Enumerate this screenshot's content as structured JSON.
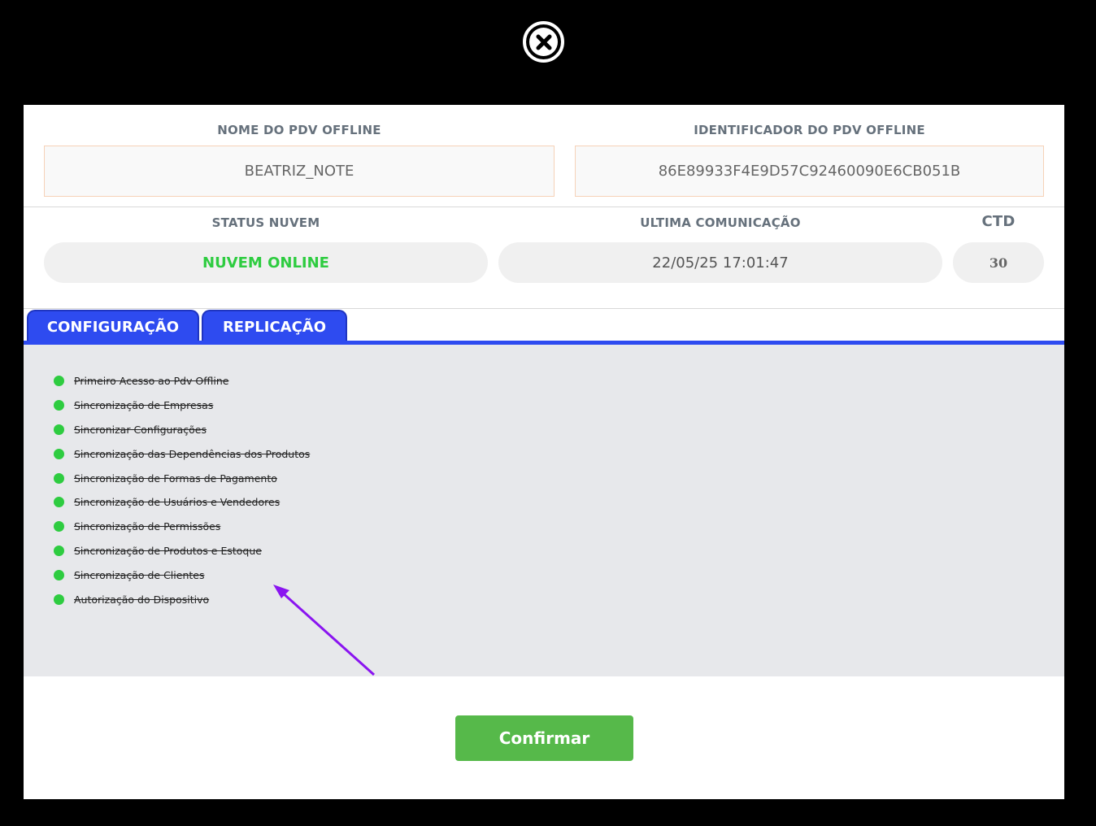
{
  "header": {
    "pdv_name_label": "NOME DO PDV OFFLINE",
    "pdv_name_value": "BEATRIZ_NOTE",
    "pdv_id_label": "IDENTIFICADOR DO PDV OFFLINE",
    "pdv_id_value": "86E89933F4E9D57C92460090E6CB051B"
  },
  "status": {
    "cloud_label": "STATUS NUVEM",
    "cloud_value": "NUVEM ONLINE",
    "cloud_color": "#2ecc40",
    "last_comm_label": "ULTIMA COMUNICAÇÃO",
    "last_comm_value": "22/05/25 17:01:47",
    "ctd_label": "CTD",
    "ctd_value": "30"
  },
  "tabs": [
    {
      "label": "CONFIGURAÇÃO"
    },
    {
      "label": "REPLICAÇÃO"
    }
  ],
  "steps": [
    {
      "label": "Primeiro Acesso ao Pdv Offline"
    },
    {
      "label": "Sincronização de Empresas"
    },
    {
      "label": "Sincronizar Configurações"
    },
    {
      "label": "Sincronização das Dependências dos Produtos"
    },
    {
      "label": "Sincronização de Formas de Pagamento"
    },
    {
      "label": "Sincronização de Usuários e Vendedores"
    },
    {
      "label": "Sincronização de Permissões"
    },
    {
      "label": "Sincronização de Produtos e Estoque"
    },
    {
      "label": "Sincronização de Clientes"
    },
    {
      "label": "Autorização do Dispositivo"
    }
  ],
  "footer": {
    "confirm_label": "Confirmar"
  },
  "icons": {
    "close": "close-icon",
    "step_status": "green-dot-icon",
    "annotation": "purple-arrow"
  },
  "colors": {
    "accent": "#2e4bf0",
    "success": "#56b94a",
    "annotation": "#8a14f0"
  }
}
